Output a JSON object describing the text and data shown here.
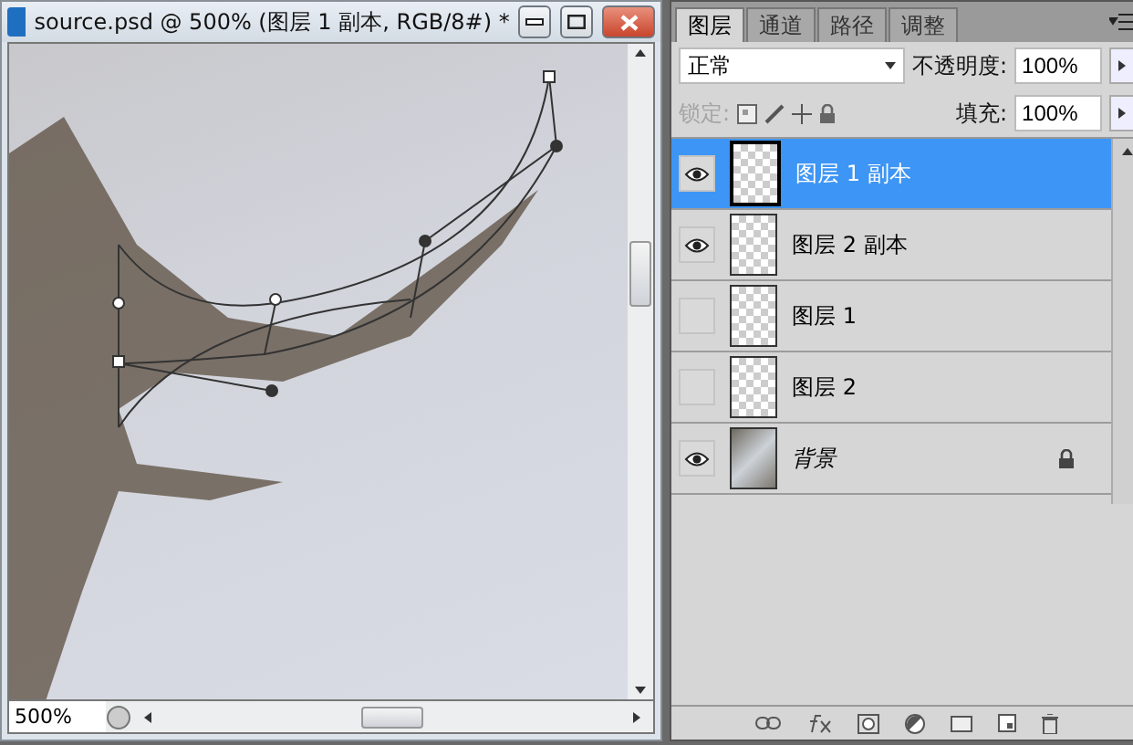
{
  "document": {
    "title": "source.psd @ 500% (图层 1 副本, RGB/8#) *",
    "zoom": "500%"
  },
  "panel": {
    "tabs": [
      {
        "label": "图层",
        "selected": true
      },
      {
        "label": "通道",
        "selected": false
      },
      {
        "label": "路径",
        "selected": false
      },
      {
        "label": "调整",
        "selected": false
      }
    ],
    "blend_mode": "正常",
    "opacity_label": "不透明度:",
    "opacity": "100%",
    "lock_label": "锁定:",
    "fill_label": "填充:",
    "fill": "100%",
    "layers": [
      {
        "name": "图层 1 副本",
        "visible": true,
        "selected": true,
        "kind": "transparent",
        "locked": false
      },
      {
        "name": "图层 2 副本",
        "visible": true,
        "selected": false,
        "kind": "transparent",
        "locked": false
      },
      {
        "name": "图层 1",
        "visible": false,
        "selected": false,
        "kind": "transparent",
        "locked": false
      },
      {
        "name": "图层 2",
        "visible": false,
        "selected": false,
        "kind": "transparent",
        "locked": false
      },
      {
        "name": "背景",
        "visible": true,
        "selected": false,
        "kind": "photo",
        "locked": true
      }
    ]
  }
}
